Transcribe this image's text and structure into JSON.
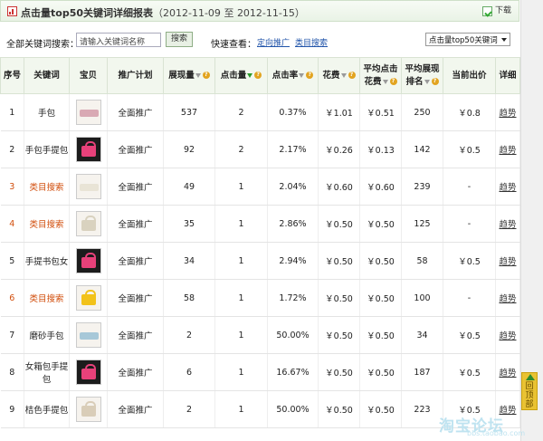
{
  "header": {
    "title": "点击量top50关键词详细报表",
    "range_open": "（",
    "date_start": "2012-11-09",
    "range_sep": "至",
    "date_end": "2012-11-15",
    "range_close": "）",
    "download_label": "下载"
  },
  "filter": {
    "search_label": "全部关键词搜索：",
    "search_placeholder": "请输入关键词名称",
    "search_button": "搜索",
    "quick_view_label": "快速查看：",
    "quick_link_1": "定向推广",
    "quick_link_2": "类目搜索",
    "select_value": "点击量top50关键词"
  },
  "table": {
    "headers": {
      "index": "序号",
      "keyword": "关键词",
      "item": "宝贝",
      "plan": "推广计划",
      "impressions": "展现量",
      "clicks": "点击量",
      "ctr": "点击率",
      "cost": "花费",
      "avg_cpc_1": "平均点击",
      "avg_cpc_2": "花费",
      "avg_rank_1": "平均展现",
      "avg_rank_2": "排名",
      "bid": "当前出价",
      "detail": "详细"
    },
    "rows": [
      {
        "index": "1",
        "keyword": "手包",
        "red": false,
        "thumb": "light",
        "bag_color": "#d9a9b4",
        "bag_shape": "flat",
        "plan": "全面推广",
        "impressions": "537",
        "clicks": "2",
        "ctr": "0.37%",
        "cost": "￥1.01",
        "avg_cpc": "￥0.51",
        "avg_rank": "250",
        "bid": "￥0.8",
        "detail": "趋势"
      },
      {
        "index": "2",
        "keyword": "手包手提包",
        "red": false,
        "thumb": "dark",
        "bag_color": "#e8417a",
        "bag_shape": "normal",
        "plan": "全面推广",
        "impressions": "92",
        "clicks": "2",
        "ctr": "2.17%",
        "cost": "￥0.26",
        "avg_cpc": "￥0.13",
        "avg_rank": "142",
        "bid": "￥0.5",
        "detail": "趋势"
      },
      {
        "index": "3",
        "keyword": "类目搜索",
        "red": true,
        "thumb": "light",
        "bag_color": "#e9e4d6",
        "bag_shape": "flat",
        "plan": "全面推广",
        "impressions": "49",
        "clicks": "1",
        "ctr": "2.04%",
        "cost": "￥0.60",
        "avg_cpc": "￥0.60",
        "avg_rank": "239",
        "bid": "-",
        "detail": "趋势"
      },
      {
        "index": "4",
        "keyword": "类目搜索",
        "red": true,
        "thumb": "light",
        "bag_color": "#d9d2bf",
        "bag_shape": "normal",
        "plan": "全面推广",
        "impressions": "35",
        "clicks": "1",
        "ctr": "2.86%",
        "cost": "￥0.50",
        "avg_cpc": "￥0.50",
        "avg_rank": "125",
        "bid": "-",
        "detail": "趋势"
      },
      {
        "index": "5",
        "keyword": "手提书包女",
        "red": false,
        "thumb": "dark",
        "bag_color": "#e8417a",
        "bag_shape": "normal",
        "plan": "全面推广",
        "impressions": "34",
        "clicks": "1",
        "ctr": "2.94%",
        "cost": "￥0.50",
        "avg_cpc": "￥0.50",
        "avg_rank": "58",
        "bid": "￥0.5",
        "detail": "趋势"
      },
      {
        "index": "6",
        "keyword": "类目搜索",
        "red": true,
        "thumb": "light",
        "bag_color": "#f2c21a",
        "bag_shape": "normal",
        "plan": "全面推广",
        "impressions": "58",
        "clicks": "1",
        "ctr": "1.72%",
        "cost": "￥0.50",
        "avg_cpc": "￥0.50",
        "avg_rank": "100",
        "bid": "-",
        "detail": "趋势"
      },
      {
        "index": "7",
        "keyword": "磨砂手包",
        "red": false,
        "thumb": "light",
        "bag_color": "#a7c8d8",
        "bag_shape": "flat",
        "plan": "全面推广",
        "impressions": "2",
        "clicks": "1",
        "ctr": "50.00%",
        "cost": "￥0.50",
        "avg_cpc": "￥0.50",
        "avg_rank": "34",
        "bid": "￥0.5",
        "detail": "趋势"
      },
      {
        "index": "8",
        "keyword": "女箱包手提包",
        "red": false,
        "thumb": "dark",
        "bag_color": "#e8417a",
        "bag_shape": "normal",
        "plan": "全面推广",
        "impressions": "6",
        "clicks": "1",
        "ctr": "16.67%",
        "cost": "￥0.50",
        "avg_cpc": "￥0.50",
        "avg_rank": "187",
        "bid": "￥0.5",
        "detail": "趋势"
      },
      {
        "index": "9",
        "keyword": "桔色手提包",
        "red": false,
        "thumb": "light",
        "bag_color": "#d9cdb8",
        "bag_shape": "normal",
        "plan": "全面推广",
        "impressions": "2",
        "clicks": "1",
        "ctr": "50.00%",
        "cost": "￥0.50",
        "avg_cpc": "￥0.50",
        "avg_rank": "223",
        "bid": "￥0.5",
        "detail": "趋势"
      }
    ]
  },
  "back_to_top": "回顶部",
  "watermark": {
    "main": "淘宝论坛",
    "sub": "bbs.taobao.com"
  },
  "colors": {
    "accent_green": "#2a9a2a",
    "red_text": "#d2500f",
    "header_bg": "#f2f7ee",
    "help_orange": "#e2a420"
  }
}
